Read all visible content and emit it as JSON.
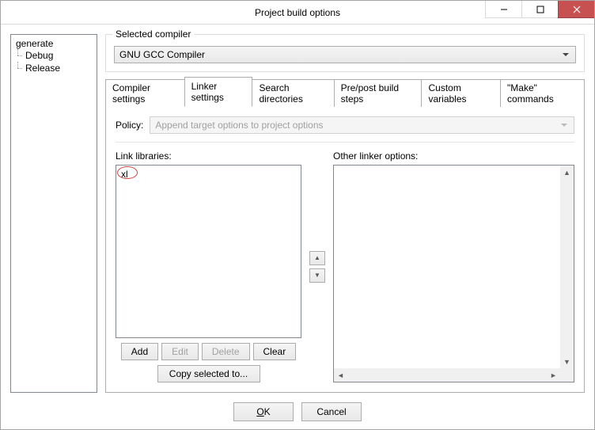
{
  "window": {
    "title": "Project build options"
  },
  "tree": {
    "root": "generate",
    "children": [
      "Debug",
      "Release"
    ]
  },
  "compiler_group": {
    "legend": "Selected compiler",
    "value": "GNU GCC Compiler"
  },
  "tabs": [
    "Compiler settings",
    "Linker settings",
    "Search directories",
    "Pre/post build steps",
    "Custom variables",
    "\"Make\" commands"
  ],
  "active_tab_index": 1,
  "policy": {
    "label": "Policy:",
    "value": "Append target options to project options"
  },
  "link_libraries": {
    "label": "Link libraries:",
    "items": [
      "xl"
    ]
  },
  "other_linker": {
    "label": "Other linker options:"
  },
  "buttons": {
    "add": "Add",
    "edit": "Edit",
    "delete": "Delete",
    "clear": "Clear",
    "copy": "Copy selected to...",
    "ok": "OK",
    "cancel": "Cancel"
  }
}
